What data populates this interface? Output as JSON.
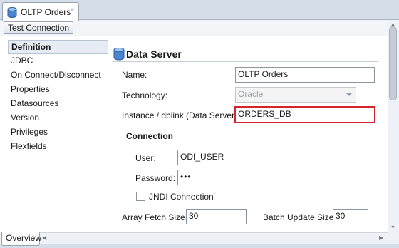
{
  "tab": {
    "title": "OLTP Orders",
    "close_glyph": "×",
    "icon": "database-icon"
  },
  "toolbar": {
    "test_connection_label": "Test Connection"
  },
  "nav": {
    "items": [
      {
        "label": "Definition",
        "selected": true
      },
      {
        "label": "JDBC"
      },
      {
        "label": "On Connect/Disconnect"
      },
      {
        "label": "Properties"
      },
      {
        "label": "Datasources"
      },
      {
        "label": "Version"
      },
      {
        "label": "Privileges"
      },
      {
        "label": "Flexfields"
      }
    ]
  },
  "form": {
    "section_title": "Data Server",
    "name": {
      "label": "Name:",
      "value": "OLTP Orders"
    },
    "technology": {
      "label": "Technology:",
      "value": "Oracle"
    },
    "instance": {
      "label": "Instance / dblink (Data Server):",
      "value": "ORDERS_DB"
    },
    "connection": {
      "title": "Connection",
      "user": {
        "label": "User:",
        "value": "ODI_USER"
      },
      "password": {
        "label": "Password:",
        "value": "•••"
      },
      "jndi": {
        "label": "JNDI Connection",
        "checked": false
      }
    },
    "array_fetch": {
      "label": "Array Fetch Size:",
      "value": "30"
    },
    "batch_update": {
      "label": "Batch Update Size:",
      "value": "30"
    }
  },
  "bottom_tab": {
    "label": "Overview"
  },
  "colors": {
    "highlight": "#d6242c",
    "nav_selected_bg": "#e7ecf4"
  }
}
